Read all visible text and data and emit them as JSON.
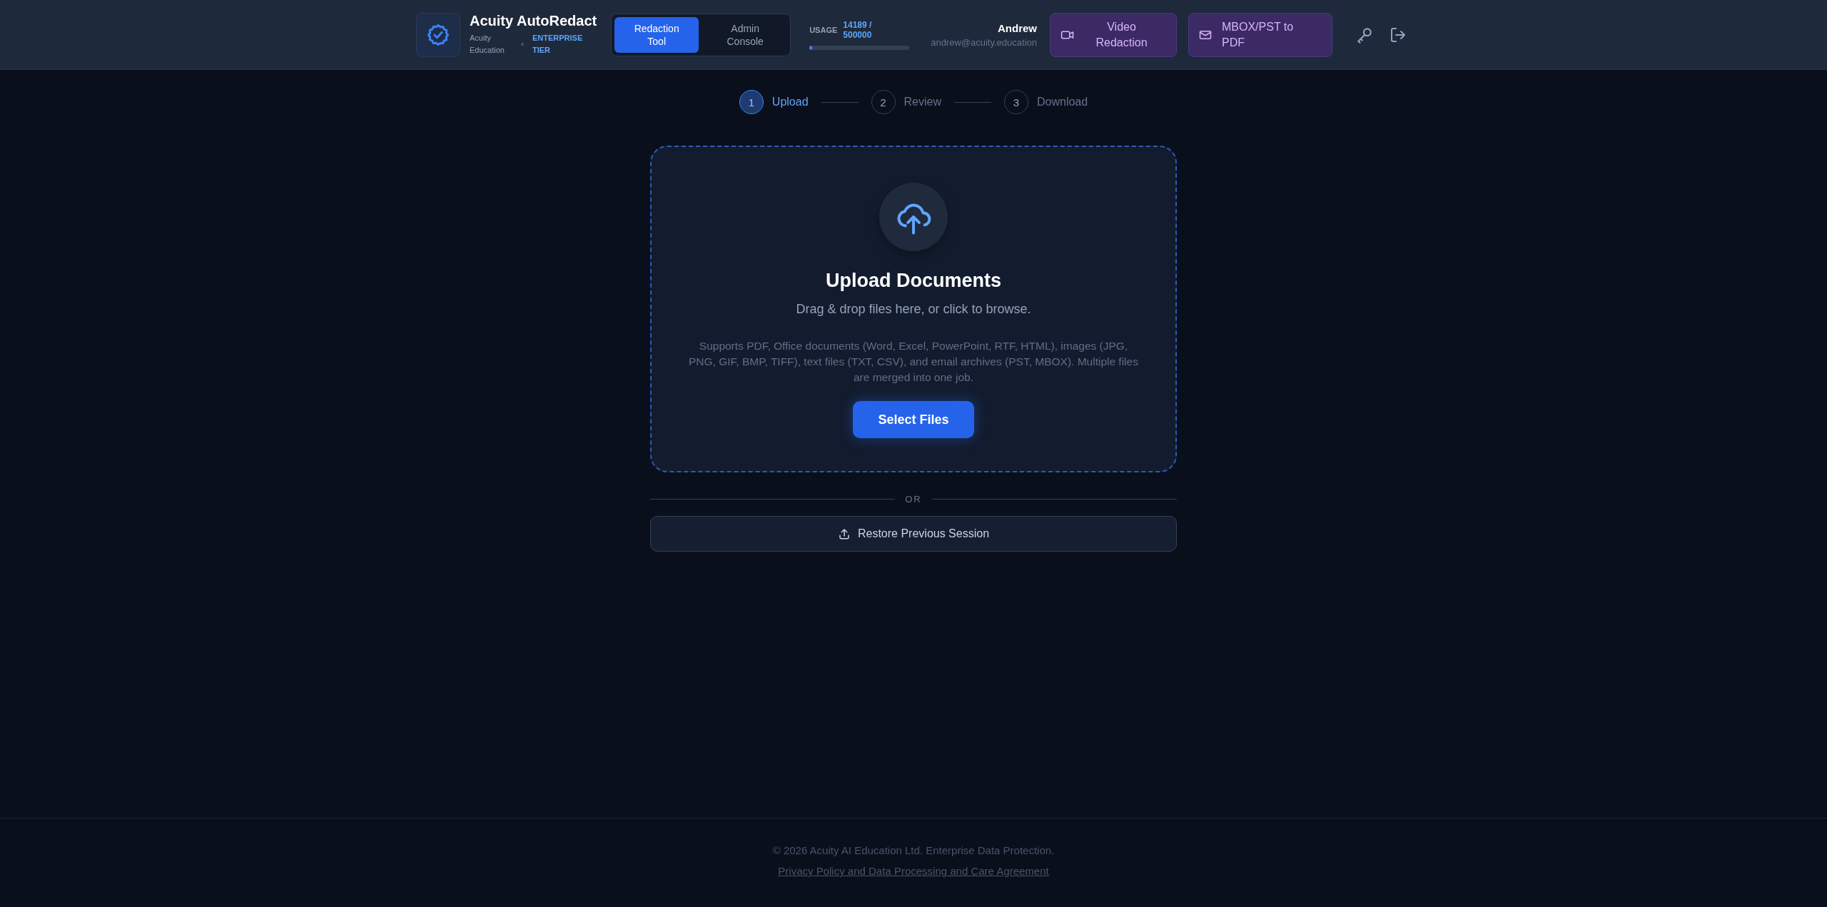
{
  "header": {
    "app_name": "Acuity AutoRedact",
    "org": "Acuity Education",
    "tier": "ENTERPRISE TIER",
    "tabs": [
      {
        "label": "Redaction Tool",
        "selected": true
      },
      {
        "label": "Admin Console",
        "selected": false
      }
    ],
    "usage": {
      "label": "USAGE",
      "reading": "14189 / 500000",
      "level": 0.028
    },
    "user": {
      "name": "Andrew",
      "email": "andrew@acuity.education"
    },
    "actions": [
      {
        "kind": "video",
        "label": "Video Redaction"
      },
      {
        "kind": "mail",
        "label": "MBOX/PST to PDF"
      }
    ]
  },
  "steps": [
    {
      "number": "1",
      "label": "Upload",
      "selected": true
    },
    {
      "number": "2",
      "label": "Review",
      "selected": false
    },
    {
      "number": "3",
      "label": "Download",
      "selected": false
    }
  ],
  "upload": {
    "title": "Upload Documents",
    "subtitle": "Drag & drop files here, or click to browse.",
    "description": "Supports PDF, Office documents (Word, Excel, PowerPoint, RTF, HTML), images (JPG, PNG, GIF, BMP, TIFF), text files (TXT, CSV), and email archives (PST, MBOX). Multiple files are merged into one job.",
    "button": "Select Files"
  },
  "divider": "OR",
  "restore_button": "Restore Previous Session",
  "footer": {
    "copyright": "© 2026 Acuity AI Education Ltd. Enterprise Data Protection.",
    "link": "Privacy Policy and Data Processing and Care Agreement"
  }
}
